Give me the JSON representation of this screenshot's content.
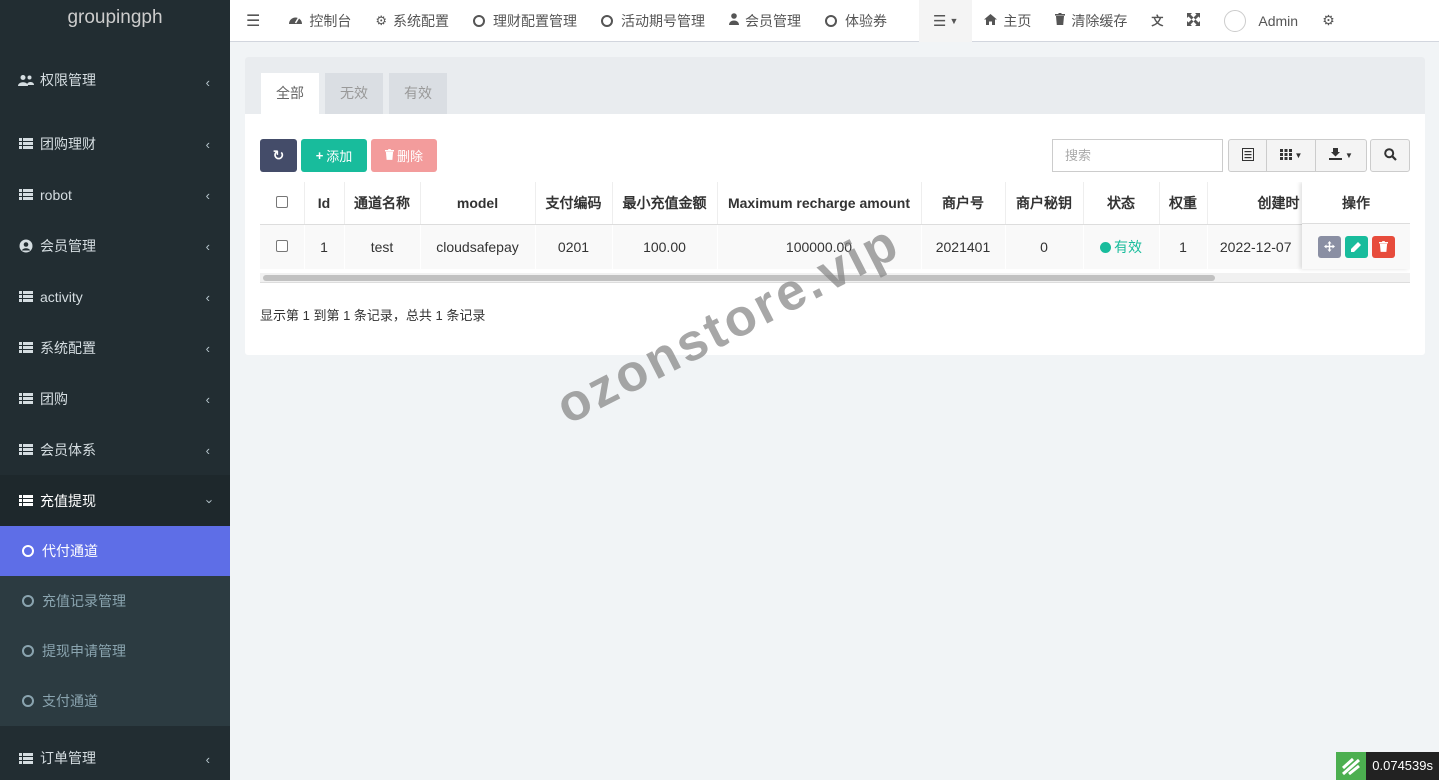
{
  "app": {
    "logo": "groupingph"
  },
  "sidebar": {
    "items": [
      {
        "label": "权限管理",
        "icon": "users-icon"
      },
      {
        "label": "团购理财",
        "icon": "list-icon"
      },
      {
        "label": "robot",
        "icon": "list-icon"
      },
      {
        "label": "会员管理",
        "icon": "user-circle-icon"
      },
      {
        "label": "activity",
        "icon": "list-icon"
      },
      {
        "label": "系统配置",
        "icon": "list-icon"
      },
      {
        "label": "团购",
        "icon": "list-icon"
      },
      {
        "label": "会员体系",
        "icon": "list-icon"
      },
      {
        "label": "充值提现",
        "icon": "list-icon"
      }
    ],
    "subitems": [
      {
        "label": "代付通道",
        "active": true
      },
      {
        "label": "充值记录管理"
      },
      {
        "label": "提现申请管理"
      },
      {
        "label": "支付通道"
      }
    ],
    "after": {
      "label": "订单管理",
      "icon": "list-icon"
    }
  },
  "topbar": {
    "items": [
      {
        "label": "控制台",
        "icon": "dashboard-icon"
      },
      {
        "label": "系统配置",
        "icon": "gear-icon"
      },
      {
        "label": "理财配置管理",
        "icon": "circle-icon"
      },
      {
        "label": "活动期号管理",
        "icon": "circle-icon"
      },
      {
        "label": "会员管理",
        "icon": "user-icon"
      },
      {
        "label": "体验券",
        "icon": "circle-icon"
      }
    ],
    "home": "主页",
    "clear_cache": "清除缓存",
    "user": "Admin"
  },
  "tabs": [
    "全部",
    "无效",
    "有效"
  ],
  "toolbar": {
    "add": "添加",
    "delete": "删除",
    "search_placeholder": "搜索"
  },
  "table": {
    "columns": [
      "Id",
      "通道名称",
      "model",
      "支付编码",
      "最小充值金额",
      "Maximum recharge amount",
      "商户号",
      "商户秘钥",
      "状态",
      "权重",
      "创建时"
    ],
    "ops_header": "操作",
    "rows": [
      [
        "1",
        "test",
        "cloudsafepay",
        "0201",
        "100.00",
        "100000.00",
        "2021401",
        "0",
        "有效",
        "1",
        "2022-12-07"
      ]
    ]
  },
  "pager": "显示第 1 到第 1 条记录，总共 1 条记录",
  "watermark": "ozonstore.vip",
  "timer": "0.074539s",
  "colors": {
    "sidebar": "#222d32",
    "active": "#5e6ee7",
    "success": "#18bc9c",
    "danger": "#f39c9c",
    "primary": "#444c69"
  }
}
